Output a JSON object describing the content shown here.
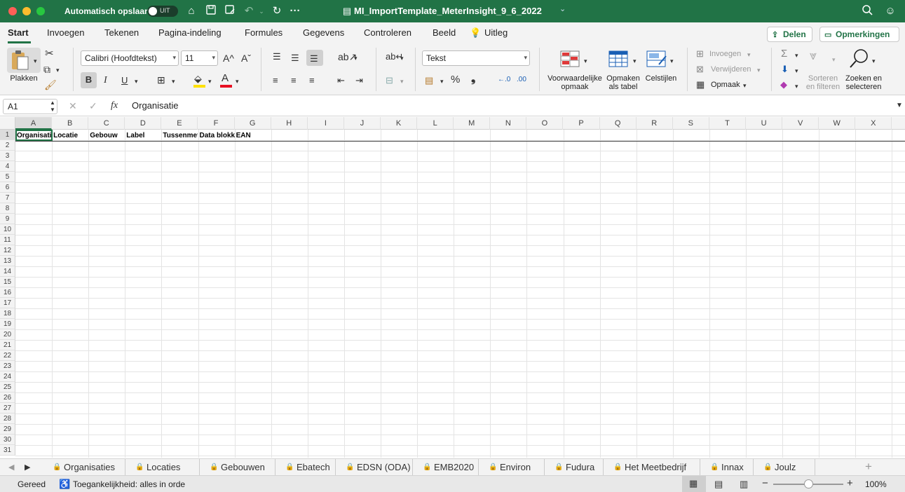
{
  "titlebar": {
    "autosave_label": "Automatisch opslaan",
    "autosave_state": "UIT",
    "document_title": "MI_ImportTemplate_MeterInsight_9_6_2022",
    "title_chevron": "⌄",
    "more": "···"
  },
  "tabs": [
    "Start",
    "Invoegen",
    "Tekenen",
    "Pagina-indeling",
    "Formules",
    "Gegevens",
    "Controleren",
    "Beeld",
    "Uitleg"
  ],
  "share_label": "Delen",
  "comments_label": "Opmerkingen",
  "ribbon": {
    "paste_label": "Plakken",
    "font_name": "Calibri (Hoofdtekst)",
    "font_size": "11",
    "grow_font": "A^",
    "shrink_font": "Aˇ",
    "bold": "B",
    "italic": "I",
    "underline": "U",
    "number_format": "Tekst",
    "percent": "%",
    "comma": "❟",
    "cond_format_l1": "Voorwaardelijke",
    "cond_format_l2": "opmaak",
    "format_table_l1": "Opmaken",
    "format_table_l2": "als tabel",
    "cell_styles": "Celstijlen",
    "insert": "Invoegen",
    "delete": "Verwijderen",
    "format": "Opmaak",
    "sort_l1": "Sorteren",
    "sort_l2": "en filteren",
    "find_l1": "Zoeken en",
    "find_l2": "selecteren"
  },
  "formula_bar": {
    "name_box": "A1",
    "fx": "fx",
    "content": "Organisatie"
  },
  "grid": {
    "columns": [
      "A",
      "B",
      "C",
      "D",
      "E",
      "F",
      "G",
      "H",
      "I",
      "J",
      "K",
      "L",
      "M",
      "N",
      "O",
      "P",
      "Q",
      "R",
      "S",
      "T",
      "U",
      "V",
      "W",
      "X"
    ],
    "rows": [
      "1",
      "2",
      "3",
      "4",
      "5",
      "6",
      "7",
      "8",
      "9",
      "10",
      "11",
      "12",
      "13",
      "14",
      "15",
      "16",
      "17",
      "18",
      "19",
      "20",
      "21",
      "22",
      "23",
      "24",
      "25",
      "26",
      "27",
      "28",
      "29",
      "30",
      "31"
    ],
    "row1": [
      "Organisatie",
      "Locatie",
      "Gebouw",
      "Label",
      "Tussenmeter",
      "Data blokken",
      "EAN"
    ]
  },
  "sheets": [
    "Organisaties",
    "Locaties",
    "Gebouwen",
    "Ebatech",
    "EDSN (ODA)",
    "EMB2020",
    "Environ",
    "Fudura",
    "Het Meetbedrijf",
    "Innax",
    "Joulz"
  ],
  "status": {
    "ready": "Gereed",
    "accessibility": "Toegankelijkheid: alles in orde",
    "zoom": "100%",
    "zoom_level": 1.0
  },
  "colors": {
    "accent": "#217346",
    "font_color_red": "#e81123",
    "highlight_yellow": "#ffe100"
  }
}
